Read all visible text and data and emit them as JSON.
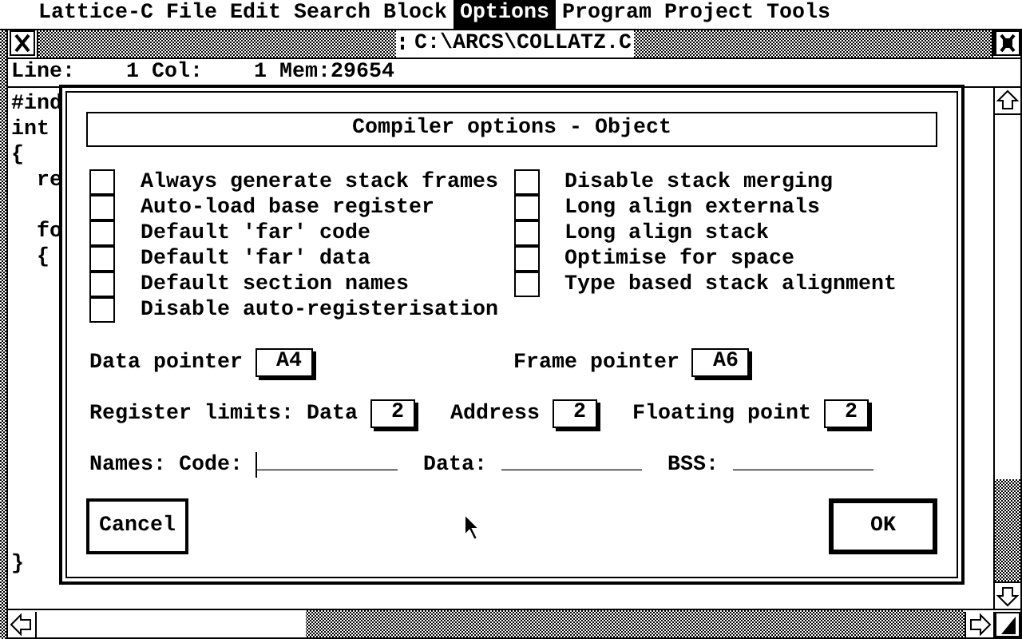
{
  "menu_bar": [
    {
      "label": "Lattice-C",
      "selected": false
    },
    {
      "label": "File",
      "selected": false
    },
    {
      "label": "Edit",
      "selected": false
    },
    {
      "label": "Search",
      "selected": false
    },
    {
      "label": "Block",
      "selected": false
    },
    {
      "label": "Options",
      "selected": true
    },
    {
      "label": "Program",
      "selected": false
    },
    {
      "label": "Project",
      "selected": false
    },
    {
      "label": "Tools",
      "selected": false
    }
  ],
  "window": {
    "title": "C:\\ARCS\\COLLATZ.C",
    "info_line": "Line:    1 Col:    1 Mem:29654"
  },
  "editor": {
    "lines": [
      "#ind",
      "int",
      "{",
      "  re",
      "  fo",
      "  {",
      "}"
    ]
  },
  "dialog": {
    "title": "Compiler options - Object",
    "options_left": [
      {
        "label": "Always generate stack frames",
        "checked": false
      },
      {
        "label": "Auto-load base register",
        "checked": false
      },
      {
        "label": "Default 'far' code",
        "checked": false
      },
      {
        "label": "Default 'far' data",
        "checked": false
      },
      {
        "label": "Default section names",
        "checked": false
      },
      {
        "label": "Disable auto-registerisation",
        "checked": false
      }
    ],
    "options_right": [
      {
        "label": "Disable stack merging",
        "checked": false
      },
      {
        "label": "Long align externals",
        "checked": false
      },
      {
        "label": "Long align stack",
        "checked": false
      },
      {
        "label": "Optimise for space",
        "checked": false
      },
      {
        "label": "Type based stack alignment",
        "checked": false
      }
    ],
    "pointers": [
      {
        "label": "Data pointer",
        "value": "A4"
      },
      {
        "label": "Frame pointer",
        "value": "A6"
      }
    ],
    "register_limits": {
      "label": "Register limits:",
      "fields": [
        {
          "label": "Data",
          "value": "2"
        },
        {
          "label": "Address",
          "value": "2"
        },
        {
          "label": "Floating point",
          "value": "2"
        }
      ]
    },
    "names": {
      "label": "Names:",
      "fields": [
        {
          "label": "Code:",
          "template": "___________",
          "focused": true
        },
        {
          "label": "Data:",
          "template": "___________",
          "focused": false
        },
        {
          "label": "BSS:",
          "template": "___________",
          "focused": false
        }
      ]
    },
    "buttons": [
      {
        "label": "Cancel",
        "default": false
      },
      {
        "label": "OK",
        "default": true
      }
    ]
  }
}
